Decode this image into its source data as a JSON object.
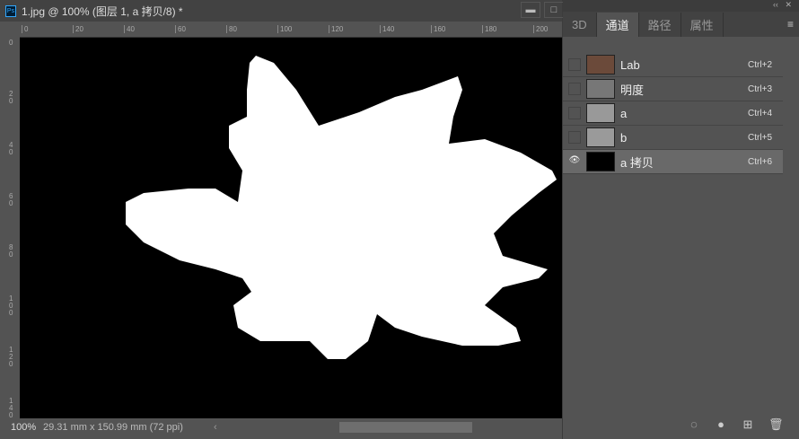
{
  "document": {
    "title": "1.jpg @ 100% (图层 1, a 拷贝/8) *",
    "minimize": "▬",
    "maximize": "□"
  },
  "ruler": {
    "h": [
      "0",
      "20",
      "40",
      "60",
      "80",
      "100",
      "120",
      "140",
      "160",
      "180",
      "200"
    ],
    "v": [
      "0",
      "20",
      "40",
      "60",
      "80",
      "100",
      "120",
      "140"
    ]
  },
  "status": {
    "zoom": "100%",
    "info": "29.31 mm x 150.99 mm (72 ppi)",
    "scroll_left": "‹"
  },
  "panel": {
    "collapse": "‹‹",
    "close": "✕",
    "tabs": [
      "3D",
      "通道",
      "路径",
      "属性"
    ],
    "menu": "≡",
    "channels": [
      {
        "name": "Lab",
        "shortcut": "Ctrl+2",
        "visible": false,
        "thumb": "#6b4a3a"
      },
      {
        "name": "明度",
        "shortcut": "Ctrl+3",
        "visible": false,
        "thumb": "#777"
      },
      {
        "name": "a",
        "shortcut": "Ctrl+4",
        "visible": false,
        "thumb": "#999"
      },
      {
        "name": "b",
        "shortcut": "Ctrl+5",
        "visible": false,
        "thumb": "#9a9a9a"
      },
      {
        "name": "a 拷贝",
        "shortcut": "Ctrl+6",
        "visible": true,
        "thumb": "#000"
      }
    ],
    "eye": "👁",
    "footer": [
      "◌",
      "●",
      "⊞",
      "🗑"
    ]
  }
}
